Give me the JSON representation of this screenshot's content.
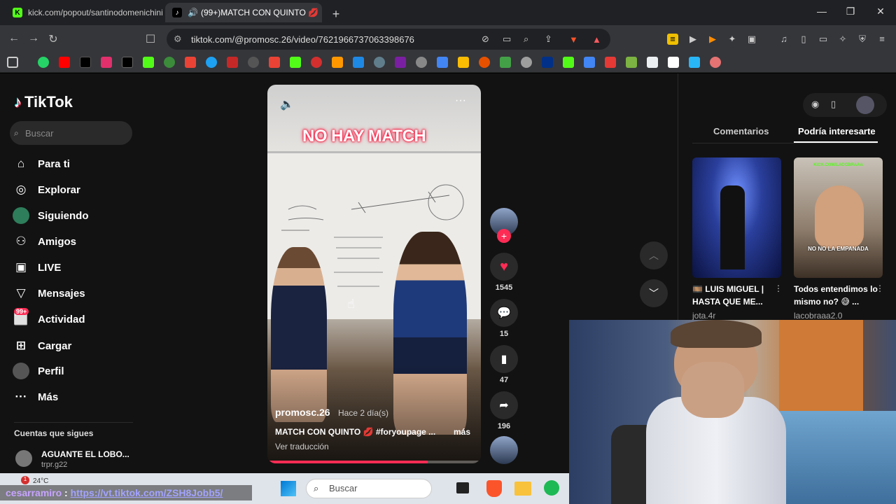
{
  "browser": {
    "tabs": [
      {
        "title": "kick.com/popout/santinodomenichini"
      },
      {
        "title": "(99+)MATCH CON QUINTO 💋"
      }
    ],
    "url": "tiktok.com/@promosc.26/video/7621966737063398676"
  },
  "tiktok": {
    "logo": "TikTok",
    "search_placeholder": "Buscar",
    "nav": [
      {
        "label": "Para ti",
        "icon": "home-icon"
      },
      {
        "label": "Explorar",
        "icon": "compass-icon"
      },
      {
        "label": "Siguiendo",
        "icon": "following-avatar-icon"
      },
      {
        "label": "Amigos",
        "icon": "friends-icon"
      },
      {
        "label": "LIVE",
        "icon": "live-icon"
      },
      {
        "label": "Mensajes",
        "icon": "messages-icon"
      },
      {
        "label": "Actividad",
        "icon": "activity-icon",
        "badge": "99+"
      },
      {
        "label": "Cargar",
        "icon": "upload-icon"
      },
      {
        "label": "Perfil",
        "icon": "profile-avatar-icon"
      },
      {
        "label": "Más",
        "icon": "more-icon"
      }
    ],
    "following_header": "Cuentas que sigues",
    "following": [
      {
        "name": "AGUANTE EL LOBO...",
        "handle": "trpr.g22"
      }
    ],
    "video": {
      "overlay_title": "NO HAY MATCH",
      "author": "promosc.26",
      "time": "Hace 2 día(s)",
      "description": "MATCH CON QUINTO 💋 #foryoupage ...",
      "more": "más",
      "translate": "Ver traducción",
      "progress": 0.75
    },
    "actions": {
      "likes": "1545",
      "comments": "15",
      "saves": "47",
      "shares": "196"
    },
    "right_panel": {
      "tabs": [
        "Comentarios",
        "Podría interesarte"
      ],
      "recommendations": [
        {
          "title": "🎞️ LUIS MIGUEL | HASTA QUE ME...",
          "author": "jota.4r"
        },
        {
          "title": "Todos entendimos lo mismo no? 😅 ...",
          "author": "lacobraaa2.0",
          "thumb_caption": "NO NO LA EMPANADA",
          "thumb_top": "KICK.COM/LACOBRAAA"
        }
      ]
    }
  },
  "taskbar": {
    "weather": "24°C",
    "search": "Buscar"
  },
  "chat_overlay": {
    "user": "cesarramiro",
    "separator": " : ",
    "message": "https://vt.tiktok.com/ZSH8Jobb5/"
  },
  "colors": {
    "tiktok_red": "#fe2c55",
    "background": "#121212"
  }
}
